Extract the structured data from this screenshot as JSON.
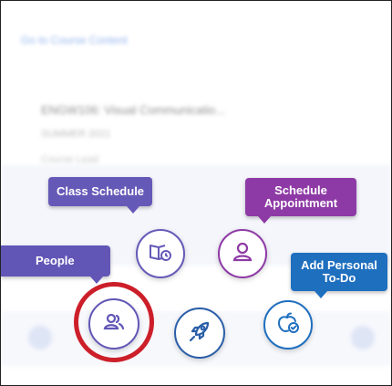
{
  "background": {
    "back_link": "Go to Course Content",
    "item_title": "ENGW106: Visual Communicatio...",
    "item_sub": "SUMMER 2021",
    "item_sub2": "Course Lead"
  },
  "actions": {
    "class_schedule": {
      "label": "Class Schedule",
      "icon": "book-clock-icon",
      "color": "#6559b8"
    },
    "schedule_appointment": {
      "label": "Schedule\nAppointment",
      "icon": "person-icon",
      "color": "#8e3aa6"
    },
    "people": {
      "label": "People",
      "icon": "people-icon",
      "color": "#6156b6",
      "highlighted": true
    },
    "launch": {
      "icon": "rocket-icon",
      "color": "#2a5ea8"
    },
    "add_personal_todo": {
      "label": "Add Personal\nTo-Do",
      "icon": "apple-check-icon",
      "color": "#1f6fbf"
    }
  },
  "highlight_color": "#cc1f2a"
}
